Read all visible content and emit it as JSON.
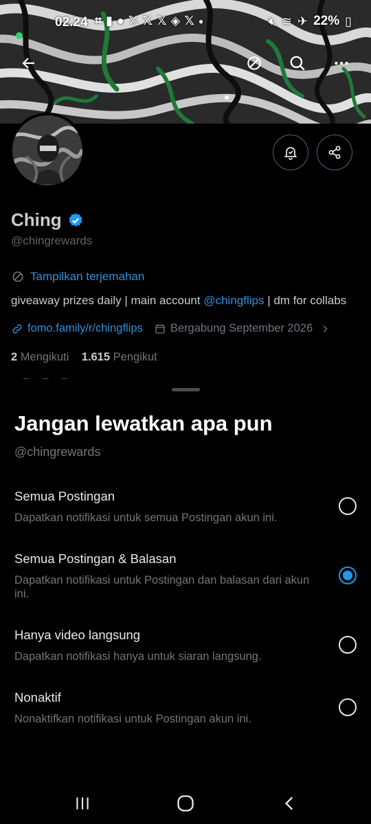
{
  "status_bar": {
    "time": "02.24",
    "left_icons": [
      "gift-icon",
      "signal-bars-icon",
      "account-icon",
      "x-icon",
      "x-icon",
      "x-icon",
      "app-icon",
      "x-icon",
      "dot-icon"
    ],
    "battery": "22%",
    "right_icons": [
      "mute-icon",
      "wifi-icon",
      "airplane-icon",
      "battery-icon"
    ]
  },
  "profile": {
    "name": "Ching",
    "handle": "@chingrewards",
    "translate_label": "Tampilkan terjemahan",
    "bio_before": "giveaway prizes daily | main account ",
    "bio_mention": "@chingflips",
    "bio_after": " | dm for collabs",
    "link": "fomo.family/r/chingflips",
    "joined": "Bergabung September 2026",
    "following_count": "2",
    "following_label": "Mengikuti",
    "followers_count": "1.615",
    "followers_label": "Pengikut"
  },
  "sheet": {
    "title": "Jangan lewatkan apa pun",
    "handle": "@chingrewards",
    "options": [
      {
        "title": "Semua Postingan",
        "desc": "Dapatkan notifikasi untuk semua Postingan akun ini.",
        "selected": false
      },
      {
        "title": "Semua Postingan & Balasan",
        "desc": "Dapatkan notifikasi untuk Postingan dan balasan dari akun ini.",
        "selected": true
      },
      {
        "title": "Hanya video langsung",
        "desc": "Dapatkan notifikasi hanya untuk siaran langsung.",
        "selected": false
      },
      {
        "title": "Nonaktif",
        "desc": "Nonaktifkan notifikasi untuk Postingan akun ini.",
        "selected": false
      }
    ]
  },
  "colors": {
    "accent": "#1d9bf0",
    "link": "#2f8fdc",
    "background": "#000000",
    "secondary_text": "#71767b"
  }
}
